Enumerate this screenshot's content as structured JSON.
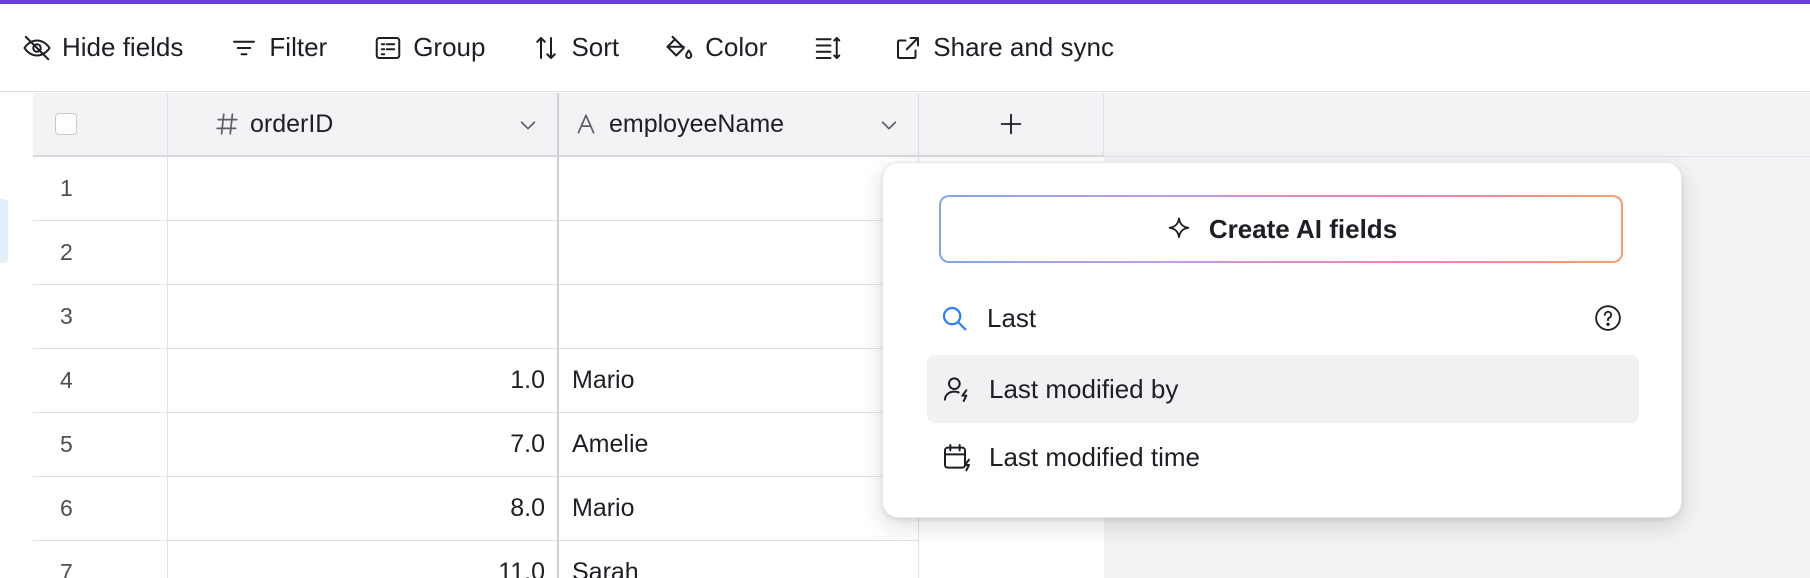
{
  "toolbar": {
    "hide_fields": "Hide fields",
    "filter": "Filter",
    "group": "Group",
    "sort": "Sort",
    "color": "Color",
    "share_sync": "Share and sync"
  },
  "columns": [
    {
      "name": "orderID",
      "type_icon": "hash-icon"
    },
    {
      "name": "employeeName",
      "type_icon": "text-icon"
    }
  ],
  "rows": [
    {
      "num": "1",
      "orderID": "",
      "employeeName": ""
    },
    {
      "num": "2",
      "orderID": "",
      "employeeName": ""
    },
    {
      "num": "3",
      "orderID": "",
      "employeeName": ""
    },
    {
      "num": "4",
      "orderID": "1.0",
      "employeeName": "Mario"
    },
    {
      "num": "5",
      "orderID": "7.0",
      "employeeName": "Amelie"
    },
    {
      "num": "6",
      "orderID": "8.0",
      "employeeName": "Mario"
    },
    {
      "num": "7",
      "orderID": "11.0",
      "employeeName": "Sarah"
    }
  ],
  "popup": {
    "ai_button": "Create AI fields",
    "search_value": "Last",
    "options": [
      {
        "label": "Last modified by",
        "icon": "user-bolt-icon"
      },
      {
        "label": "Last modified time",
        "icon": "calendar-bolt-icon"
      }
    ]
  },
  "colors": {
    "accent_bar": "#6b3fd6",
    "search_icon": "#2d7ff9"
  }
}
